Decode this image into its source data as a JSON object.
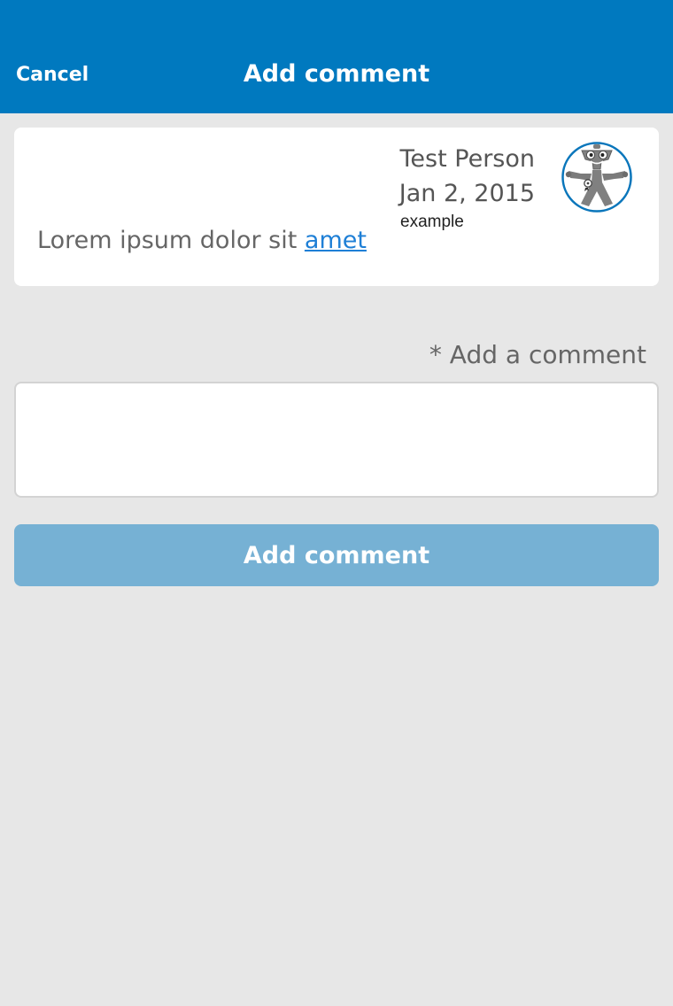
{
  "header": {
    "cancel_label": "Cancel",
    "title": "Add comment",
    "background_color": "#0079bf"
  },
  "comment": {
    "author": "Test Person",
    "date": "Jan 2, 2015",
    "tag": "example",
    "text": "Lorem ipsum dolor sit ",
    "link_text": "amet",
    "avatar_icon": "robot-mascot-avatar-icon"
  },
  "form": {
    "label": "* Add a comment",
    "input_value": "",
    "input_placeholder": "",
    "submit_label": "Add comment",
    "submit_color": "#76b1d4"
  }
}
